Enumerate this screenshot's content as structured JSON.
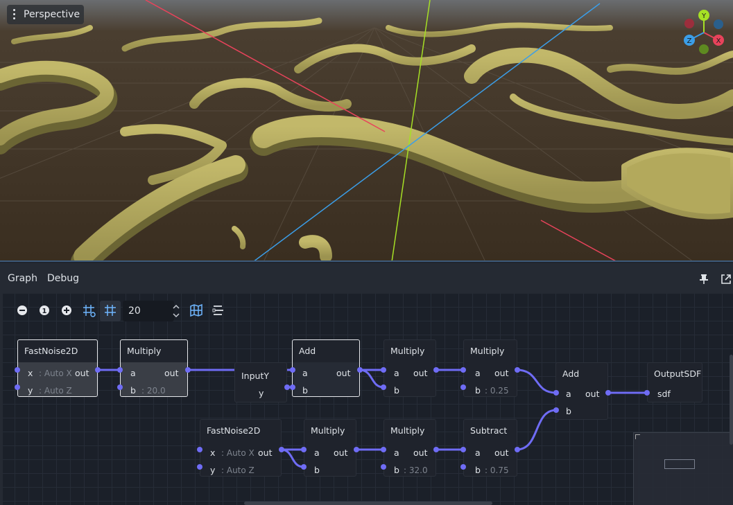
{
  "viewport": {
    "view_label": "Perspective",
    "gizmo_axes": {
      "y": "Y",
      "x": "X",
      "z": "Z"
    },
    "colors": {
      "ground": "#3b2f22",
      "terrain": "#b8ae5f",
      "x_axis": "#e8435b",
      "y_axis": "#a6e025",
      "z_axis": "#3b9ee8"
    }
  },
  "panel": {
    "tabs": [
      "Graph",
      "Debug"
    ],
    "toolbar": {
      "zoom_out_icon": "minus-circle-icon",
      "reset_zoom_icon": "one-circle-icon",
      "zoom_in_icon": "plus-circle-icon",
      "snap_icon": "grid-snap-icon",
      "grid_icon": "grid-icon",
      "snap_distance": "20",
      "minimap_icon": "minimap-icon",
      "arrange_icon": "arrange-nodes-icon"
    }
  },
  "graph": {
    "wire_color": "#6f6cf5",
    "nodes": {
      "n1": {
        "title": "FastNoise2D",
        "ports_in": [
          {
            "label": "x",
            "hint": ": Auto X"
          },
          {
            "label": "y",
            "hint": ": Auto Z"
          }
        ],
        "out": "out"
      },
      "n2": {
        "title": "Multiply",
        "ports_in": [
          {
            "label": "a",
            "hint": ""
          },
          {
            "label": "b",
            "hint": ": 20.0"
          }
        ],
        "out": "out"
      },
      "n3": {
        "title": "InputY",
        "ports_out": [
          "y"
        ]
      },
      "n4": {
        "title": "Add",
        "ports_in": [
          {
            "label": "a"
          },
          {
            "label": "b"
          }
        ],
        "out": "out"
      },
      "n5": {
        "title": "Multiply",
        "ports_in": [
          {
            "label": "a"
          },
          {
            "label": "b"
          }
        ],
        "out": "out"
      },
      "n6": {
        "title": "Multiply",
        "ports_in": [
          {
            "label": "a"
          },
          {
            "label": "b",
            "hint": ": 0.25"
          }
        ],
        "out": "out"
      },
      "n7": {
        "title": "Add",
        "ports_in": [
          {
            "label": "a"
          },
          {
            "label": "b"
          }
        ],
        "out": "out"
      },
      "n8": {
        "title": "OutputSDF",
        "ports_in": [
          {
            "label": "sdf"
          }
        ]
      },
      "n9": {
        "title": "FastNoise2D",
        "ports_in": [
          {
            "label": "x",
            "hint": ": Auto X"
          },
          {
            "label": "y",
            "hint": ": Auto Z"
          }
        ],
        "out": "out"
      },
      "n10": {
        "title": "Multiply",
        "ports_in": [
          {
            "label": "a"
          },
          {
            "label": "b"
          }
        ],
        "out": "out"
      },
      "n11": {
        "title": "Multiply",
        "ports_in": [
          {
            "label": "a"
          },
          {
            "label": "b",
            "hint": ": 32.0"
          }
        ],
        "out": "out"
      },
      "n12": {
        "title": "Subtract",
        "ports_in": [
          {
            "label": "a"
          },
          {
            "label": "b",
            "hint": ": 0.75"
          }
        ],
        "out": "out"
      }
    }
  }
}
